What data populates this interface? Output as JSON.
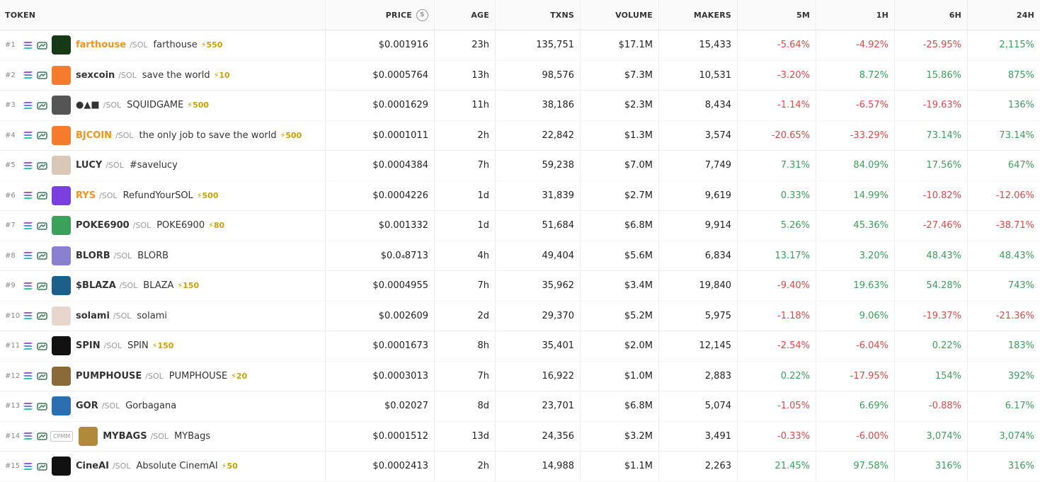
{
  "headers": {
    "token": "TOKEN",
    "price": "PRICE",
    "age": "AGE",
    "txns": "TXNS",
    "volume": "VOLUME",
    "makers": "MAKERS",
    "m5": "5M",
    "h1": "1H",
    "h6": "6H",
    "h24": "24H"
  },
  "colors": {
    "positive": "#3aa05a",
    "negative": "#e04848",
    "boost": "#c9a100",
    "orange_symbol": "#f7931a"
  },
  "rows": [
    {
      "rank": "#1",
      "sym": "farthouse",
      "chain": "/SOL",
      "name": "farthouse",
      "boost": "⚡550",
      "price": "$0.001916",
      "age": "23h",
      "txns": "135,751",
      "volume": "$17.1M",
      "makers": "15,433",
      "m5": "-5.64%",
      "h1": "-4.92%",
      "h6": "-25.95%",
      "h24": "2,115%"
    },
    {
      "rank": "#2",
      "sym": "sexcoin",
      "chain": "/SOL",
      "name": "save the world",
      "boost": "⚡10",
      "price": "$0.0005764",
      "age": "13h",
      "txns": "98,576",
      "volume": "$7.3M",
      "makers": "10,531",
      "m5": "-3.20%",
      "h1": "8.72%",
      "h6": "15.86%",
      "h24": "875%"
    },
    {
      "rank": "#3",
      "sym": "●▲■",
      "chain": "/SOL",
      "name": "SQUIDGAME",
      "boost": "⚡500",
      "price": "$0.0001629",
      "age": "11h",
      "txns": "38,186",
      "volume": "$2.3M",
      "makers": "8,434",
      "m5": "-1.14%",
      "h1": "-6.57%",
      "h6": "-19.63%",
      "h24": "136%"
    },
    {
      "rank": "#4",
      "sym": "BJCOIN",
      "chain": "/SOL",
      "name": "the only job to save the world",
      "boost": "⚡500",
      "price": "$0.0001011",
      "age": "2h",
      "txns": "22,842",
      "volume": "$1.3M",
      "makers": "3,574",
      "m5": "-20.65%",
      "h1": "-33.29%",
      "h6": "73.14%",
      "h24": "73.14%"
    },
    {
      "rank": "#5",
      "sym": "LUCY",
      "chain": "/SOL",
      "name": "#savelucy",
      "boost": "",
      "price": "$0.0004384",
      "age": "7h",
      "txns": "59,238",
      "volume": "$7.0M",
      "makers": "7,749",
      "m5": "7.31%",
      "h1": "84.09%",
      "h6": "17.56%",
      "h24": "647%"
    },
    {
      "rank": "#6",
      "sym": "RYS",
      "chain": "/SOL",
      "name": "RefundYourSOL",
      "boost": "⚡500",
      "price": "$0.0004226",
      "age": "1d",
      "txns": "31,839",
      "volume": "$2.7M",
      "makers": "9,619",
      "m5": "0.33%",
      "h1": "14.99%",
      "h6": "-10.82%",
      "h24": "-12.06%"
    },
    {
      "rank": "#7",
      "sym": "POKE6900",
      "chain": "/SOL",
      "name": "POKE6900",
      "boost": "⚡80",
      "price": "$0.001332",
      "age": "1d",
      "txns": "51,684",
      "volume": "$6.8M",
      "makers": "9,914",
      "m5": "5.26%",
      "h1": "45.36%",
      "h6": "-27.46%",
      "h24": "-38.71%"
    },
    {
      "rank": "#8",
      "sym": "BLORB",
      "chain": "/SOL",
      "name": "BLORB",
      "boost": "",
      "price": "$0.0₄8713",
      "age": "4h",
      "txns": "49,404",
      "volume": "$5.6M",
      "makers": "6,834",
      "m5": "13.17%",
      "h1": "3.20%",
      "h6": "48.43%",
      "h24": "48.43%"
    },
    {
      "rank": "#9",
      "sym": "$BLAZA",
      "chain": "/SOL",
      "name": "BLAZA",
      "boost": "⚡150",
      "price": "$0.0004955",
      "age": "7h",
      "txns": "35,962",
      "volume": "$3.4M",
      "makers": "19,840",
      "m5": "-9.40%",
      "h1": "19.63%",
      "h6": "54.28%",
      "h24": "743%"
    },
    {
      "rank": "#10",
      "sym": "solami",
      "chain": "/SOL",
      "name": "solami",
      "boost": "",
      "price": "$0.002609",
      "age": "2d",
      "txns": "29,370",
      "volume": "$5.2M",
      "makers": "5,975",
      "m5": "-1.18%",
      "h1": "9.06%",
      "h6": "-19.37%",
      "h24": "-21.36%"
    },
    {
      "rank": "#11",
      "sym": "SPIN",
      "chain": "/SOL",
      "name": "SPIN",
      "boost": "⚡150",
      "price": "$0.0001673",
      "age": "8h",
      "txns": "35,401",
      "volume": "$2.0M",
      "makers": "12,145",
      "m5": "-2.54%",
      "h1": "-6.04%",
      "h6": "0.22%",
      "h24": "183%"
    },
    {
      "rank": "#12",
      "sym": "PUMPHOUSE",
      "chain": "/SOL",
      "name": "PUMPHOUSE",
      "boost": "⚡20",
      "price": "$0.0003013",
      "age": "7h",
      "txns": "16,922",
      "volume": "$1.0M",
      "makers": "2,883",
      "m5": "0.22%",
      "h1": "-17.95%",
      "h6": "154%",
      "h24": "392%"
    },
    {
      "rank": "#13",
      "sym": "GOR",
      "chain": "/SOL",
      "name": "Gorbagana",
      "boost": "",
      "price": "$0.02027",
      "age": "8d",
      "txns": "23,701",
      "volume": "$6.8M",
      "makers": "5,074",
      "m5": "-1.05%",
      "h1": "6.69%",
      "h6": "-0.88%",
      "h24": "6.17%"
    },
    {
      "rank": "#14",
      "sym": "MYBAGS",
      "chain": "/SOL",
      "name": "MYBags",
      "boost": "",
      "badge": "CPMM",
      "price": "$0.0001512",
      "age": "13d",
      "txns": "24,356",
      "volume": "$3.2M",
      "makers": "3,491",
      "m5": "-0.33%",
      "h1": "-6.00%",
      "h6": "3,074%",
      "h24": "3,074%"
    },
    {
      "rank": "#15",
      "sym": "CineAI",
      "chain": "/SOL",
      "name": "Absolute CinemAI",
      "boost": "⚡50",
      "price": "$0.0002413",
      "age": "2h",
      "txns": "14,988",
      "volume": "$1.1M",
      "makers": "2,263",
      "m5": "21.45%",
      "h1": "97.58%",
      "h6": "316%",
      "h24": "316%"
    }
  ]
}
